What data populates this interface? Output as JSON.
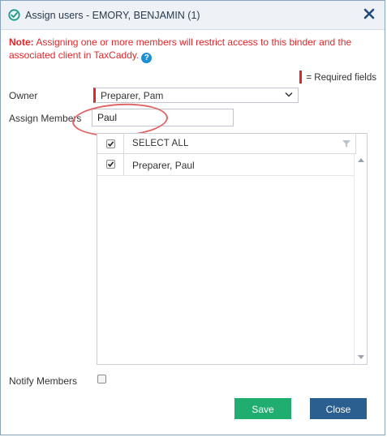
{
  "dialog": {
    "title": "Assign users - EMORY, BENJAMIN (1)"
  },
  "note": {
    "prefix": "Note:",
    "text": " Assigning one or more members will restrict access to this binder and the associated client in TaxCaddy."
  },
  "required_legend": "= Required fields",
  "owner": {
    "label": "Owner",
    "selected": "Preparer, Pam"
  },
  "assign_members": {
    "label": "Assign Members",
    "value": "Paul"
  },
  "members_list": {
    "select_all_label": "SELECT ALL",
    "select_all_checked": true,
    "items": [
      {
        "label": "Preparer, Paul",
        "checked": true
      }
    ]
  },
  "notify": {
    "label": "Notify Members",
    "checked": false
  },
  "buttons": {
    "save": "Save",
    "close": "Close"
  },
  "colors": {
    "accent_green": "#1fae6f",
    "accent_blue": "#2a5f8f",
    "required_red": "#e0262b",
    "highlight_red": "#e06666"
  },
  "icons": {
    "title": "check-circle-icon",
    "close": "close-icon",
    "help": "question-circle-icon",
    "dropdown": "chevron-down-icon",
    "filter": "filter-icon"
  }
}
